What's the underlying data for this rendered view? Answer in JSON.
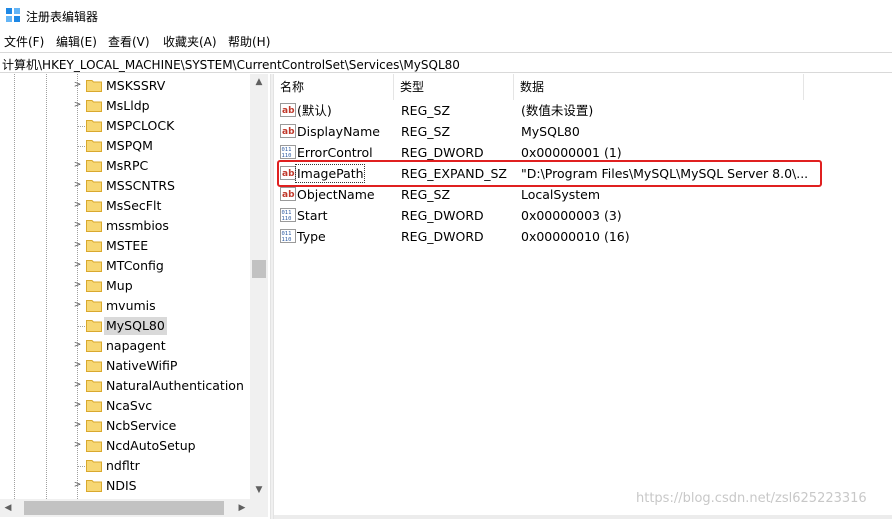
{
  "window": {
    "title": "注册表编辑器",
    "app_icon": "regedit-icon"
  },
  "menu": [
    {
      "label": "文件(F)"
    },
    {
      "label": "编辑(E)"
    },
    {
      "label": "查看(V)"
    },
    {
      "label": "收藏夹(A)"
    },
    {
      "label": "帮助(H)"
    }
  ],
  "address": {
    "path": "计算机\\HKEY_LOCAL_MACHINE\\SYSTEM\\CurrentControlSet\\Services\\MySQL80"
  },
  "tree": {
    "selected": "MySQL80",
    "items": [
      {
        "label": "MSKSSRV",
        "expandable": true
      },
      {
        "label": "MsLldp",
        "expandable": true
      },
      {
        "label": "MSPCLOCK",
        "expandable": false
      },
      {
        "label": "MSPQM",
        "expandable": false
      },
      {
        "label": "MsRPC",
        "expandable": true
      },
      {
        "label": "MSSCNTRS",
        "expandable": true
      },
      {
        "label": "MsSecFlt",
        "expandable": true
      },
      {
        "label": "mssmbios",
        "expandable": true
      },
      {
        "label": "MSTEE",
        "expandable": true
      },
      {
        "label": "MTConfig",
        "expandable": true
      },
      {
        "label": "Mup",
        "expandable": true
      },
      {
        "label": "mvumis",
        "expandable": true
      },
      {
        "label": "MySQL80",
        "expandable": false
      },
      {
        "label": "napagent",
        "expandable": true
      },
      {
        "label": "NativeWifiP",
        "expandable": true
      },
      {
        "label": "NaturalAuthentication",
        "expandable": true
      },
      {
        "label": "NcaSvc",
        "expandable": true
      },
      {
        "label": "NcbService",
        "expandable": true
      },
      {
        "label": "NcdAutoSetup",
        "expandable": true
      },
      {
        "label": "ndfltr",
        "expandable": false
      },
      {
        "label": "NDIS",
        "expandable": true
      }
    ]
  },
  "list": {
    "columns": [
      {
        "label": "名称"
      },
      {
        "label": "类型"
      },
      {
        "label": "数据"
      }
    ],
    "rows": [
      {
        "icon": "string-value-icon",
        "name": "(默认)",
        "type": "REG_SZ",
        "data": "(数值未设置)"
      },
      {
        "icon": "string-value-icon",
        "name": "DisplayName",
        "type": "REG_SZ",
        "data": "MySQL80"
      },
      {
        "icon": "dword-value-icon",
        "name": "ErrorControl",
        "type": "REG_DWORD",
        "data": "0x00000001 (1)"
      },
      {
        "icon": "string-value-icon",
        "name": "ImagePath",
        "type": "REG_EXPAND_SZ",
        "data": "\"D:\\Program Files\\MySQL\\MySQL Server 8.0\\..."
      },
      {
        "icon": "string-value-icon",
        "name": "ObjectName",
        "type": "REG_SZ",
        "data": "LocalSystem"
      },
      {
        "icon": "dword-value-icon",
        "name": "Start",
        "type": "REG_DWORD",
        "data": "0x00000003 (3)"
      },
      {
        "icon": "dword-value-icon",
        "name": "Type",
        "type": "REG_DWORD",
        "data": "0x00000010 (16)"
      }
    ],
    "highlighted_row": "ImagePath"
  },
  "colors": {
    "folder": "#f7d774",
    "folder_edge": "#d9a92e",
    "highlight_border": "#e02020",
    "selection": "#d9d9d9",
    "string_icon": "#c0392b",
    "dword_icon": "#2c5aa0"
  },
  "watermark": "https://blog.csdn.net/zsl625223316"
}
